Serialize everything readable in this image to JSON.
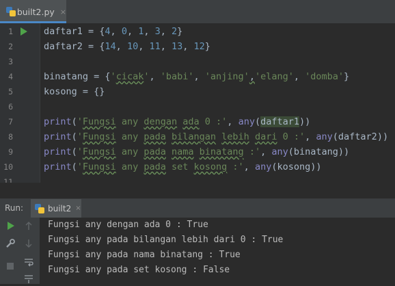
{
  "editor_tab": {
    "filename": "built2.py",
    "close": "×"
  },
  "code_lines": [
    {
      "num": "1"
    },
    {
      "num": "2"
    },
    {
      "num": "3"
    },
    {
      "num": "4"
    },
    {
      "num": "5"
    },
    {
      "num": "6"
    },
    {
      "num": "7"
    },
    {
      "num": "8"
    },
    {
      "num": "9"
    },
    {
      "num": "10"
    },
    {
      "num": "11"
    }
  ],
  "code": {
    "l1": {
      "a": "daftar1 = {",
      "n1": "4",
      "c1": ", ",
      "n2": "0",
      "c2": ", ",
      "n3": "1",
      "c3": ", ",
      "n4": "3",
      "c4": ", ",
      "n5": "2",
      "z": "}"
    },
    "l2": {
      "a": "daftar2 = {",
      "n1": "14",
      "c1": ", ",
      "n2": "10",
      "c2": ", ",
      "n3": "11",
      "c3": ", ",
      "n4": "13",
      "c4": ", ",
      "n5": "12",
      "z": "}"
    },
    "l4": {
      "a": "binatang = {",
      "s1q": "'",
      "s1": "cicak",
      "s1e": "'",
      "c1": ", ",
      "s2": "'babi'",
      "c2": ", ",
      "s3": "'anjing'",
      "c3": ",",
      "s4": "'elang'",
      "c4": ", ",
      "s5": "'domba'",
      "z": "}"
    },
    "l5": {
      "a": "kosong = {}"
    },
    "l7": {
      "fn": "print",
      "p": "(",
      "sq": "'",
      "w1": "Fungsi",
      "s1": " any ",
      "w2": "dengan",
      "s2": " ",
      "w3": "ada",
      "s3": " 0 :'",
      "c": ", ",
      "fn2": "any",
      "p2": "(",
      "arg": "daftar1",
      "z": "))"
    },
    "l8": {
      "fn": "print",
      "p": "(",
      "sq": "'",
      "w1": "Fungsi",
      "s1": " any ",
      "w2": "pada",
      "s2": " ",
      "w3": "bilangan",
      "s3": " ",
      "w4": "lebih",
      "s4": " ",
      "w5": "dari",
      "s5": " 0 :'",
      "c": ", ",
      "fn2": "any",
      "p2": "(",
      "arg": "daftar2",
      "z": "))"
    },
    "l9": {
      "fn": "print",
      "p": "(",
      "sq": "'",
      "w1": "Fungsi",
      "s1": " any ",
      "w2": "pada",
      "s2": " ",
      "w3": "nama",
      "s3": " ",
      "w4": "binatang",
      "s4": " :'",
      "c": ", ",
      "fn2": "any",
      "p2": "(",
      "arg": "binatang",
      "z": "))"
    },
    "l10": {
      "fn": "print",
      "p": "(",
      "sq": "'",
      "w1": "Fungsi",
      "s1": " any ",
      "w2": "pada",
      "s2": " set ",
      "w3": "kosong",
      "s3": " :'",
      "c": ", ",
      "fn2": "any",
      "p2": "(",
      "arg": "kosong",
      "z": "))"
    }
  },
  "run_panel": {
    "title": "Run:",
    "tab": "built2",
    "close": "×"
  },
  "console_output": [
    "Fungsi any dengan ada 0 : True",
    "Fungsi any pada bilangan lebih dari 0 : True",
    "Fungsi any pada nama binatang : True",
    "Fungsi any pada set kosong : False"
  ],
  "icons": {
    "run": "run-icon",
    "settings": "wrench-icon",
    "stop": "stop-icon",
    "up": "arrow-up-icon",
    "down": "arrow-down-icon",
    "wrap": "soft-wrap-icon",
    "scroll": "scroll-to-end-icon"
  },
  "colors": {
    "keyword_num": "#6897bb",
    "string": "#6a8759",
    "builtin": "#8888c6",
    "run_green": "#4fa34a",
    "tab_accent": "#4a88c7"
  }
}
